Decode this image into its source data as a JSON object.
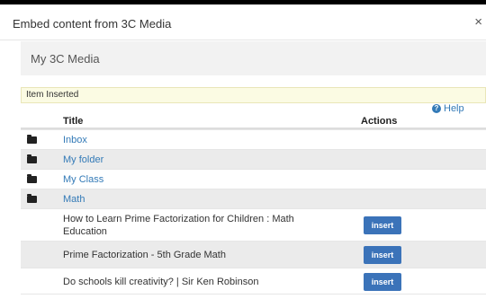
{
  "dialog": {
    "title": "Embed content from 3C Media",
    "close_symbol": "×"
  },
  "breadcrumb": {
    "label": "My 3C Media"
  },
  "notice": {
    "text": "Item Inserted"
  },
  "help": {
    "label": "Help",
    "icon_symbol": "?"
  },
  "table": {
    "columns": {
      "title": "Title",
      "actions": "Actions"
    },
    "folders": [
      {
        "name": "Inbox",
        "icon": "folder-icon"
      },
      {
        "name": "My folder",
        "icon": "folder-icon"
      },
      {
        "name": "My Class",
        "icon": "folder-icon"
      },
      {
        "name": "Math",
        "icon": "folder-icon"
      }
    ],
    "media": [
      {
        "title": "How to Learn Prime Factorization for Children : Math Education",
        "action": "insert"
      },
      {
        "title": "Prime Factorization - 5th Grade Math",
        "action": "insert"
      },
      {
        "title": "Do schools kill creativity? | Sir Ken Robinson",
        "action": "insert"
      }
    ]
  },
  "colors": {
    "link": "#337ab7",
    "button": "#3b73b9",
    "notice_bg": "#fbfbe3",
    "row_alt": "#ebebeb"
  }
}
